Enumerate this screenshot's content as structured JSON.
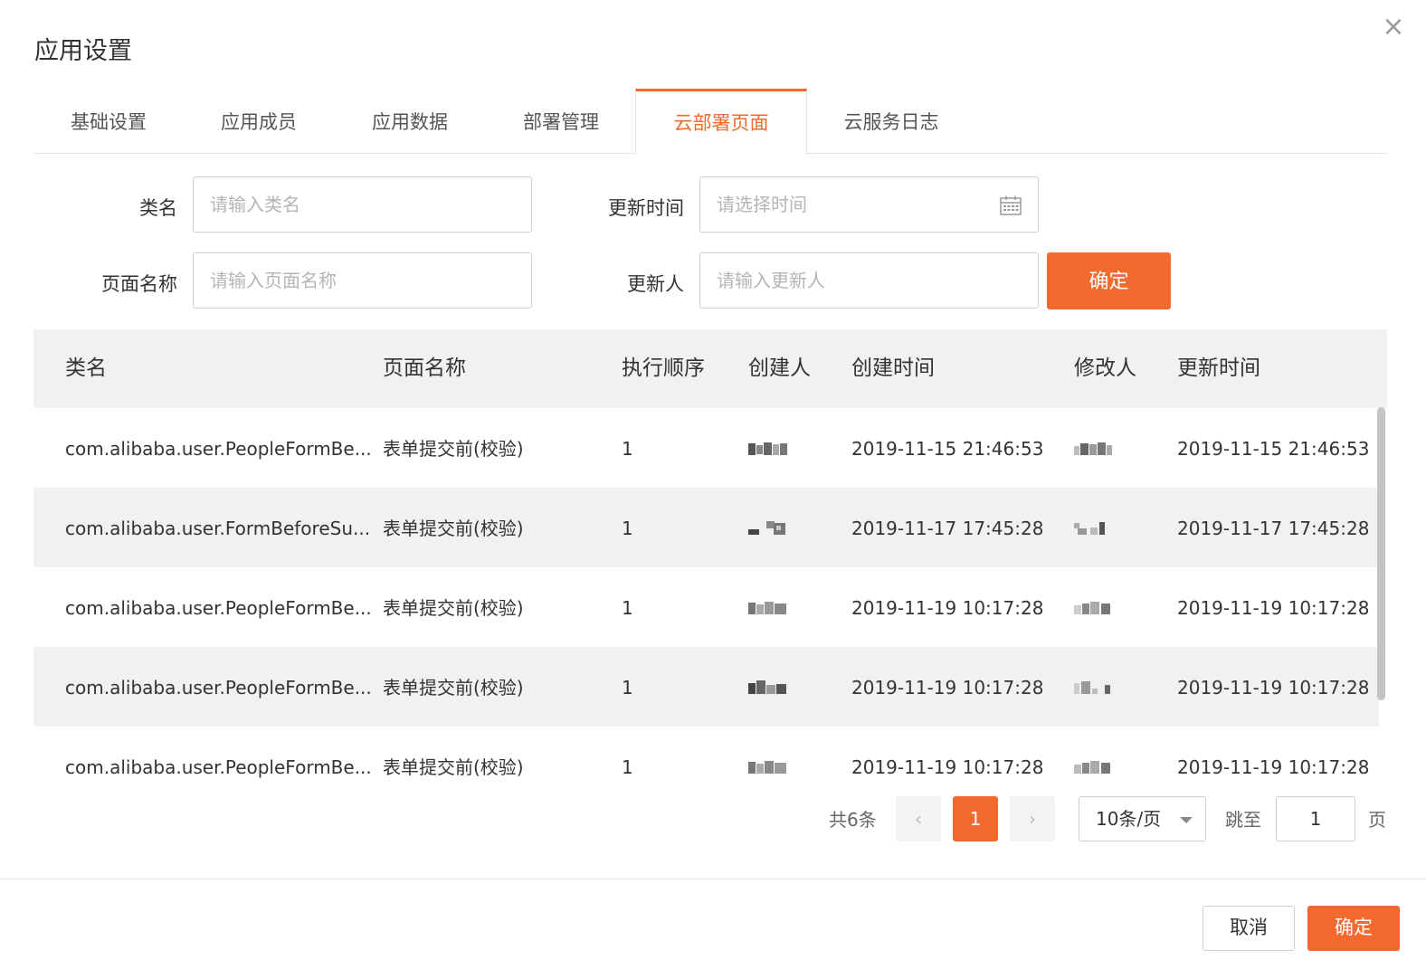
{
  "dialog": {
    "title": "应用设置",
    "close": "×"
  },
  "tabs": [
    {
      "label": "基础设置",
      "active": false
    },
    {
      "label": "应用成员",
      "active": false
    },
    {
      "label": "应用数据",
      "active": false
    },
    {
      "label": "部署管理",
      "active": false
    },
    {
      "label": "云部署页面",
      "active": true
    },
    {
      "label": "云服务日志",
      "active": false
    }
  ],
  "filters": {
    "class_name": {
      "label": "类名",
      "placeholder": "请输入类名",
      "value": ""
    },
    "update_time": {
      "label": "更新时间",
      "placeholder": "请选择时间",
      "value": ""
    },
    "page_name": {
      "label": "页面名称",
      "placeholder": "请输入页面名称",
      "value": ""
    },
    "updater": {
      "label": "更新人",
      "placeholder": "请输入更新人",
      "value": ""
    },
    "submit_label": "确定"
  },
  "table": {
    "columns": [
      "类名",
      "页面名称",
      "执行顺序",
      "创建人",
      "创建时间",
      "修改人",
      "更新时间"
    ],
    "rows": [
      {
        "class_name": "com.alibaba.user.PeopleFormBe...",
        "page_name": "表单提交前(校验)",
        "order": "1",
        "creator": "",
        "created": "2019-11-15 21:46:53",
        "modifier": "",
        "updated": "2019-11-15 21:46:53"
      },
      {
        "class_name": "com.alibaba.user.FormBeforeSu...",
        "page_name": "表单提交前(校验)",
        "order": "1",
        "creator": "",
        "created": "2019-11-17 17:45:28",
        "modifier": "",
        "updated": "2019-11-17 17:45:28"
      },
      {
        "class_name": "com.alibaba.user.PeopleFormBe...",
        "page_name": "表单提交前(校验)",
        "order": "1",
        "creator": "",
        "created": "2019-11-19 10:17:28",
        "modifier": "",
        "updated": "2019-11-19 10:17:28"
      },
      {
        "class_name": "com.alibaba.user.PeopleFormBe...",
        "page_name": "表单提交前(校验)",
        "order": "1",
        "creator": "",
        "created": "2019-11-19 10:17:28",
        "modifier": "",
        "updated": "2019-11-19 10:17:28"
      },
      {
        "class_name": "com.alibaba.user.PeopleFormBe...",
        "page_name": "表单提交前(校验)",
        "order": "1",
        "creator": "",
        "created": "2019-11-19 10:17:28",
        "modifier": "",
        "updated": "2019-11-19 10:17:28"
      }
    ]
  },
  "pagination": {
    "total_text": "共6条",
    "prev": "‹",
    "current": "1",
    "next": "›",
    "page_size": "10条/页",
    "jump_label": "跳至",
    "jump_value": "1",
    "page_suffix": "页"
  },
  "footer": {
    "cancel_label": "取消",
    "confirm_label": "确定"
  },
  "colors": {
    "accent": "#f26a2e",
    "header_bg": "#f0f1f3",
    "border": "#cfcfcf"
  }
}
